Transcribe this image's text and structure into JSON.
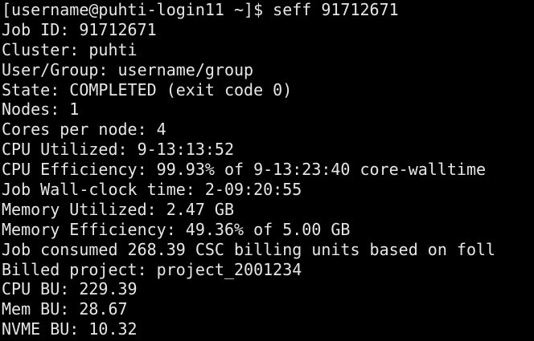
{
  "terminal": {
    "colors": {
      "background": "#000000",
      "foreground": "#e6e6e6"
    },
    "lines": [
      "[username@puhti-login11 ~]$ seff 91712671",
      "Job ID: 91712671",
      "Cluster: puhti",
      "User/Group: username/group",
      "State: COMPLETED (exit code 0)",
      "Nodes: 1",
      "Cores per node: 4",
      "CPU Utilized: 9-13:13:52",
      "CPU Efficiency: 99.93% of 9-13:23:40 core-walltime",
      "Job Wall-clock time: 2-09:20:55",
      "Memory Utilized: 2.47 GB",
      "Memory Efficiency: 49.36% of 5.00 GB",
      "Job consumed 268.39 CSC billing units based on foll",
      "Billed project: project_2001234",
      "CPU BU: 229.39",
      "Mem BU: 28.67",
      "NVME BU: 10.32"
    ]
  }
}
